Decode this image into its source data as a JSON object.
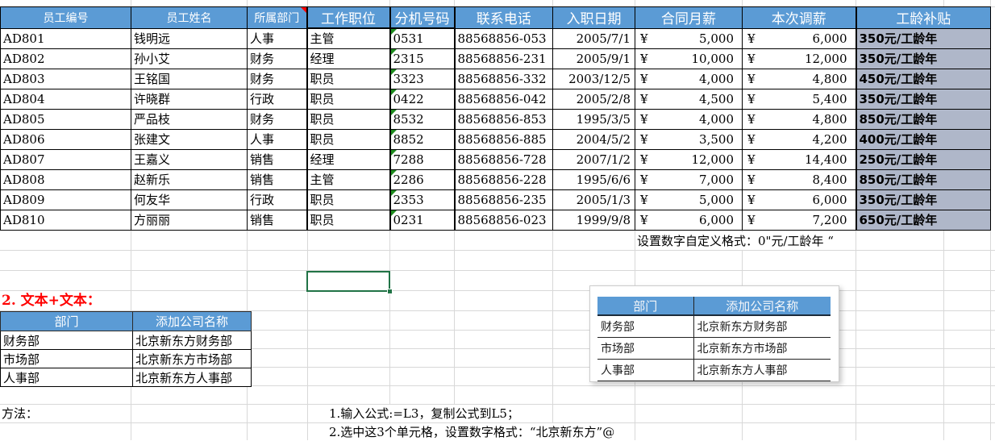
{
  "colors": {
    "header_blue": "#5B9BD5",
    "allowance_fill": "#AFB7C9",
    "selection_green": "#217346",
    "heading_red": "#FF0000"
  },
  "main_table": {
    "currency_symbol": "¥",
    "columns": [
      {
        "key": "id",
        "label": "员工编号"
      },
      {
        "key": "name",
        "label": "员工姓名"
      },
      {
        "key": "dept",
        "label": "所属部门"
      },
      {
        "key": "position",
        "label": "工作职位"
      },
      {
        "key": "ext",
        "label": "分机号码"
      },
      {
        "key": "phone",
        "label": "联系电话"
      },
      {
        "key": "hire_date",
        "label": "入职日期"
      },
      {
        "key": "salary",
        "label": "合同月薪"
      },
      {
        "key": "adjusted",
        "label": "本次调薪"
      },
      {
        "key": "allowance",
        "label": "工龄补贴"
      }
    ],
    "rows": [
      {
        "id": "AD801",
        "name": "钱明远",
        "dept": "人事",
        "position": "主管",
        "ext": "0531",
        "phone": "88568856-053",
        "hire_date": "2005/7/1",
        "salary": "5,000",
        "adjusted": "6,000",
        "allowance": "350元/工龄年"
      },
      {
        "id": "AD802",
        "name": "孙小艾",
        "dept": "财务",
        "position": "经理",
        "ext": "2315",
        "phone": "88568856-231",
        "hire_date": "2005/9/1",
        "salary": "10,000",
        "adjusted": "12,000",
        "allowance": "350元/工龄年"
      },
      {
        "id": "AD803",
        "name": "王铭国",
        "dept": "财务",
        "position": "职员",
        "ext": "3323",
        "phone": "88568856-332",
        "hire_date": "2003/12/5",
        "salary": "4,000",
        "adjusted": "4,800",
        "allowance": "450元/工龄年"
      },
      {
        "id": "AD804",
        "name": "许晓群",
        "dept": "行政",
        "position": "职员",
        "ext": "0422",
        "phone": "88568856-042",
        "hire_date": "2005/2/8",
        "salary": "4,500",
        "adjusted": "5,400",
        "allowance": "350元/工龄年"
      },
      {
        "id": "AD805",
        "name": "严品枝",
        "dept": "财务",
        "position": "职员",
        "ext": "8532",
        "phone": "88568856-853",
        "hire_date": "1995/3/5",
        "salary": "4,000",
        "adjusted": "4,800",
        "allowance": "850元/工龄年"
      },
      {
        "id": "AD806",
        "name": "张建文",
        "dept": "人事",
        "position": "职员",
        "ext": "8852",
        "phone": "88568856-885",
        "hire_date": "2004/5/2",
        "salary": "3,500",
        "adjusted": "4,200",
        "allowance": "400元/工龄年"
      },
      {
        "id": "AD807",
        "name": "王嘉义",
        "dept": "销售",
        "position": "经理",
        "ext": "7288",
        "phone": "88568856-728",
        "hire_date": "2007/1/2",
        "salary": "12,000",
        "adjusted": "14,400",
        "allowance": "250元/工龄年"
      },
      {
        "id": "AD808",
        "name": "赵新乐",
        "dept": "销售",
        "position": "主管",
        "ext": "2286",
        "phone": "88568856-228",
        "hire_date": "1995/6/6",
        "salary": "7,000",
        "adjusted": "8,400",
        "allowance": "850元/工龄年"
      },
      {
        "id": "AD809",
        "name": "何友华",
        "dept": "行政",
        "position": "职员",
        "ext": "2353",
        "phone": "88568856-235",
        "hire_date": "2005/1/3",
        "salary": "5,000",
        "adjusted": "6,000",
        "allowance": "350元/工龄年"
      },
      {
        "id": "AD810",
        "name": "方丽丽",
        "dept": "销售",
        "position": "职员",
        "ext": "0231",
        "phone": "88568856-023",
        "hire_date": "1999/9/8",
        "salary": "6,000",
        "adjusted": "7,200",
        "allowance": "650元/工龄年"
      }
    ]
  },
  "format_note": "设置数字自定义格式：0\"元/工龄年 “",
  "section2": {
    "heading": "2. 文本+文本：",
    "table": {
      "headers": [
        "部门",
        "添加公司名称"
      ],
      "rows": [
        [
          "财务部",
          "北京新东方财务部"
        ],
        [
          "市场部",
          "北京新东方市场部"
        ],
        [
          "人事部",
          "北京新东方人事部"
        ]
      ]
    }
  },
  "pasted_table": {
    "headers": [
      "部门",
      "添加公司名称"
    ],
    "rows": [
      [
        "财务部",
        "北京新东方财务部"
      ],
      [
        "市场部",
        "北京新东方市场部"
      ],
      [
        "人事部",
        "北京新东方人事部"
      ]
    ]
  },
  "method": {
    "label": "方法：",
    "steps": [
      "1.输入公式:=L3，复制公式到L5；",
      "2.选中这3个单元格，设置数字格式：“北京新东方”@"
    ]
  }
}
